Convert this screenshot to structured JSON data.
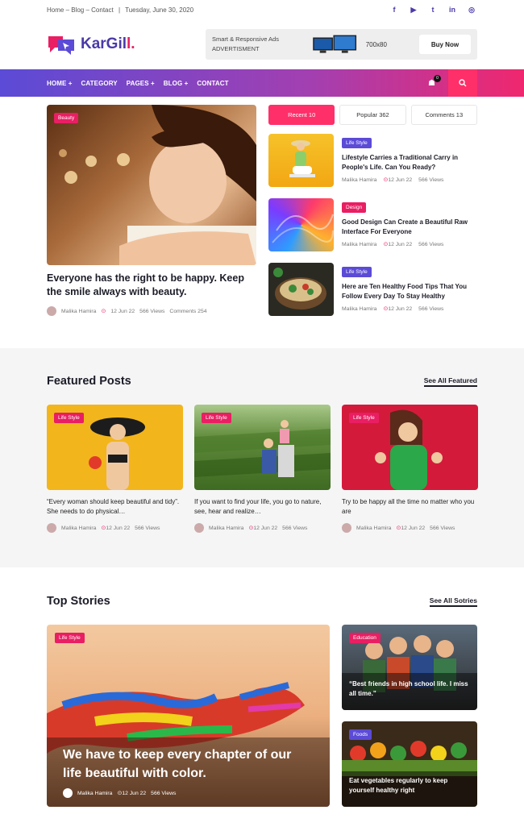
{
  "topbar": {
    "breadcrumb": "Home – Blog – Contact",
    "separator": "|",
    "date": "Tuesday, June 30, 2020",
    "socials": [
      "facebook-icon",
      "youtube-icon",
      "twitter-icon",
      "linkedin-icon",
      "whatsapp-icon"
    ]
  },
  "header": {
    "logo_text": "KarGil",
    "logo_dot": "l.",
    "ad_line1": "Smart & Responsive Ads",
    "ad_line2": "ADVERTISMENT",
    "ad_size": "700x80",
    "buy_label": "Buy Now"
  },
  "nav": {
    "items": [
      "HOME +",
      "CATEGORY",
      "PAGES +",
      "BLOG +",
      "CONTACT"
    ],
    "cart_count": "0"
  },
  "hero": {
    "badge": "Beauty",
    "title": "Everyone has the right to be happy. Keep the smile always with beauty.",
    "author": "Malika Hamira",
    "date": "12 Jun 22",
    "views": "566 Views",
    "comments": "Comments 254"
  },
  "tabs": [
    "Recent 10",
    "Popular 362",
    "Comments 13"
  ],
  "recent": [
    {
      "badge": "Life Style",
      "title": "Lifestyle Carries a Traditional Carry in People's Life. Can You Ready?",
      "author": "Malika Hamira",
      "date": "12 Jun 22",
      "views": "566 Views"
    },
    {
      "badge": "Design",
      "title": "Good Design Can Create a Beautiful Raw Interface For Everyone",
      "author": "Malika Hamira",
      "date": "12 Jun 22",
      "views": "566 Views"
    },
    {
      "badge": "Life Style",
      "title": "Here are Ten Healthy Food Tips That You Follow Every Day To Stay Healthy",
      "author": "Malika Hamira",
      "date": "12 Jun 22",
      "views": "566 Views"
    }
  ],
  "featured": {
    "heading": "Featured Posts",
    "see_all": "See All Featured",
    "cards": [
      {
        "badge": "Life Style",
        "text": "“Every woman should keep beautiful and tidy”. She needs to do physical…",
        "author": "Malika Hamira",
        "date": "12 Jun 22",
        "views": "566 Views"
      },
      {
        "badge": "Life Style",
        "text": "If you want to find your life, you go to nature, see, hear and realize…",
        "author": "Malika Hamira",
        "date": "12 Jun 22",
        "views": "566 Views"
      },
      {
        "badge": "Life Style",
        "text": "Try to be happy all the time no matter who you are",
        "author": "Malika Hamira",
        "date": "12 Jun 22",
        "views": "566 Views"
      }
    ]
  },
  "top_stories": {
    "heading": "Top Stories",
    "see_all": "See All Sotries",
    "big": {
      "badge": "Life Style",
      "title": "We have to keep every chapter of our life beautiful with color.",
      "author": "Malika Hamira",
      "date": "12 Jun 22",
      "views": "566 Views"
    },
    "small": [
      {
        "badge": "Education",
        "text": "“Best friends in high school life. I miss all time.”"
      },
      {
        "badge": "Foods",
        "text": "Eat vegetables regularly to keep yourself healthy right"
      }
    ]
  },
  "colors": {
    "brand": "#5b4bd6",
    "accent": "#ff2f6a"
  }
}
